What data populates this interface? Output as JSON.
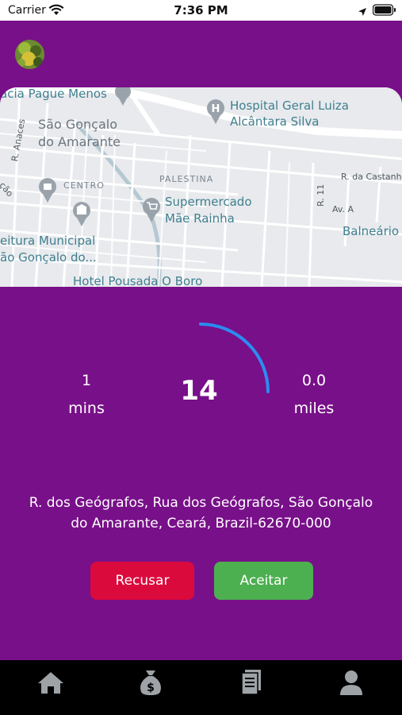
{
  "status_bar": {
    "carrier": "Carrier",
    "time": "7:36 PM",
    "icons": [
      "wifi-icon",
      "location-arrow-icon",
      "battery-icon"
    ]
  },
  "header": {
    "avatar_icon": "user-avatar"
  },
  "map": {
    "labels": {
      "farmacia": "acia Pague Menos",
      "hospital_line1": "Hospital Geral Luiza",
      "hospital_line2": "Alcântara Silva",
      "city_line1": "São Gonçalo",
      "city_line2": "do Amarante",
      "r_anaces": "R. Anaces",
      "centro": "CENTRO",
      "palestina": "PALESTINA",
      "supermarket_line1": "Supermercado",
      "supermarket_line2": "Mãe Rainha",
      "r_castanhe": "R. da Castanhe",
      "r11": "R. 11",
      "av_a": "Av. A",
      "balneario": "Balneário c",
      "prefeitura_line1": "eitura Municipal",
      "prefeitura_line2": "ão Gonçalo do...",
      "hotel": "Hotel Pousada O Boro",
      "side_road": "ção"
    },
    "colors": {
      "background": "#e8eaed",
      "road": "#ffffff",
      "railway": "#b5c8d2",
      "poi_pin": "#9aa3ab"
    }
  },
  "trip": {
    "duration_value": "1",
    "duration_unit": "mins",
    "countdown": "14",
    "distance_value": "0.0",
    "distance_unit": "miles",
    "countdown_progress": 0.25
  },
  "address": {
    "line1": "R. dos Geógrafos, Rua dos Geógrafos, São Gonçalo",
    "line2": "do Amarante, Ceará, Brazil-62670-000"
  },
  "actions": {
    "reject_label": "Recusar",
    "accept_label": "Aceitar"
  },
  "tab_bar": {
    "items": [
      {
        "icon": "home-icon"
      },
      {
        "icon": "money-bag-icon"
      },
      {
        "icon": "receipt-icon"
      },
      {
        "icon": "profile-icon"
      }
    ]
  },
  "colors": {
    "background": "#781089",
    "reject": "#db0a3d",
    "accept": "#4caf50",
    "timer_arc": "#2b8cf0",
    "tab_icon": "#9ea3a8"
  }
}
